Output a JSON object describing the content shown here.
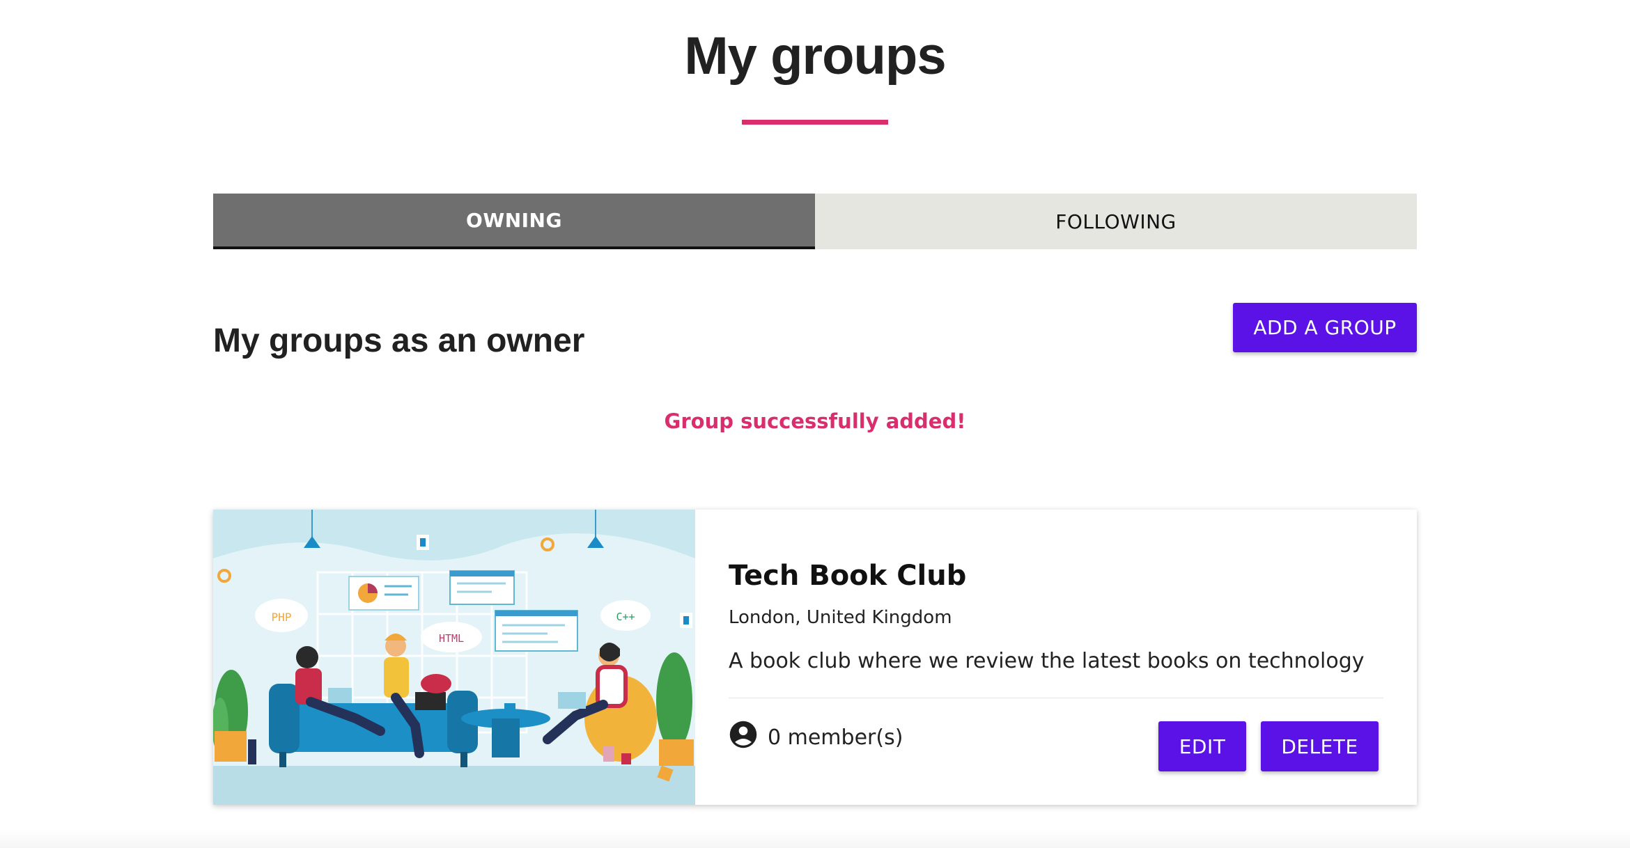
{
  "page": {
    "title": "My groups"
  },
  "tabs": [
    {
      "label": "OWNING",
      "active": true
    },
    {
      "label": "FOLLOWING",
      "active": false
    }
  ],
  "owner_section": {
    "heading": "My groups as an owner",
    "add_button_label": "ADD A GROUP",
    "success_message": "Group successfully added!"
  },
  "groups": [
    {
      "name": "Tech Book Club",
      "location": "London, United Kingdom",
      "description": "A book club where we review the latest books on technology",
      "members_text": "0 member(s)",
      "edit_label": "EDIT",
      "delete_label": "DELETE",
      "image_labels": {
        "php": "PHP",
        "html": "HTML",
        "cpp": "C++"
      }
    }
  ],
  "colors": {
    "accent": "#d92d6e",
    "primary_button": "#5b12e6",
    "tab_active_bg": "#6f6f6f",
    "tab_inactive_bg": "#e6e6e1"
  },
  "icons": {
    "member": "account-circle-icon"
  }
}
